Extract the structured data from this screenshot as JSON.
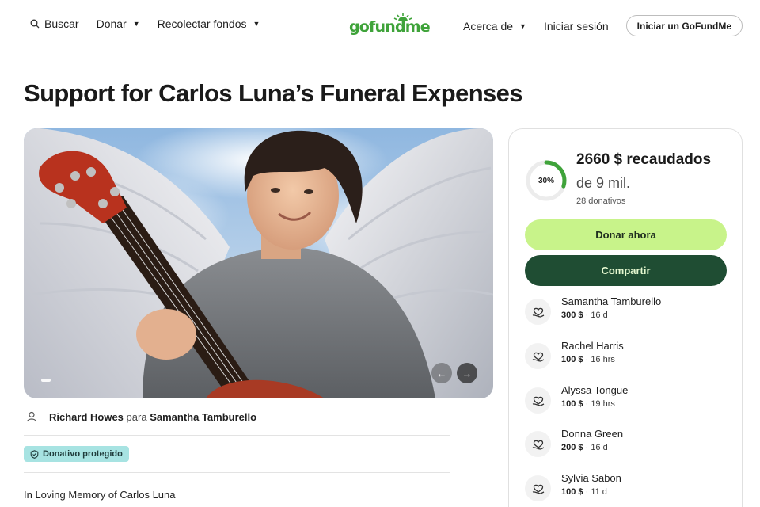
{
  "header": {
    "search_label": "Buscar",
    "donate_label": "Donar",
    "fundraise_label": "Recolectar fondos",
    "logo_text": "gofundme",
    "about_label": "Acerca de",
    "signin_label": "Iniciar sesión",
    "start_label": "Iniciar un GoFundMe"
  },
  "campaign": {
    "title": "Support for Carlos Luna’s Funeral Expenses",
    "organizer": "Richard Howes",
    "para_label": "para",
    "beneficiary": "Samantha Tamburello",
    "protected_label": "Donativo protegido",
    "story_start": "In Loving Memory of Carlos Luna"
  },
  "summary": {
    "percent_label": "30%",
    "percent_value": 0.3,
    "raised": "2660 $ recaudados",
    "goal": "de 9 mil.",
    "donations_count": "28 donativos",
    "donate_button": "Donar ahora",
    "share_button": "Compartir"
  },
  "donors": [
    {
      "name": "Samantha Tamburello",
      "amount": "300 $",
      "time": "16 d"
    },
    {
      "name": "Rachel Harris",
      "amount": "100 $",
      "time": "16 hrs"
    },
    {
      "name": "Alyssa Tongue",
      "amount": "100 $",
      "time": "19 hrs"
    },
    {
      "name": "Donna Green",
      "amount": "200 $",
      "time": "16 d"
    },
    {
      "name": "Sylvia Sabon",
      "amount": "100 $",
      "time": "11 d"
    }
  ],
  "colors": {
    "brand_green": "#3fa33a",
    "donate_button": "#c8f38a",
    "share_button": "#1f4d33",
    "badge": "#a7e3e2"
  }
}
